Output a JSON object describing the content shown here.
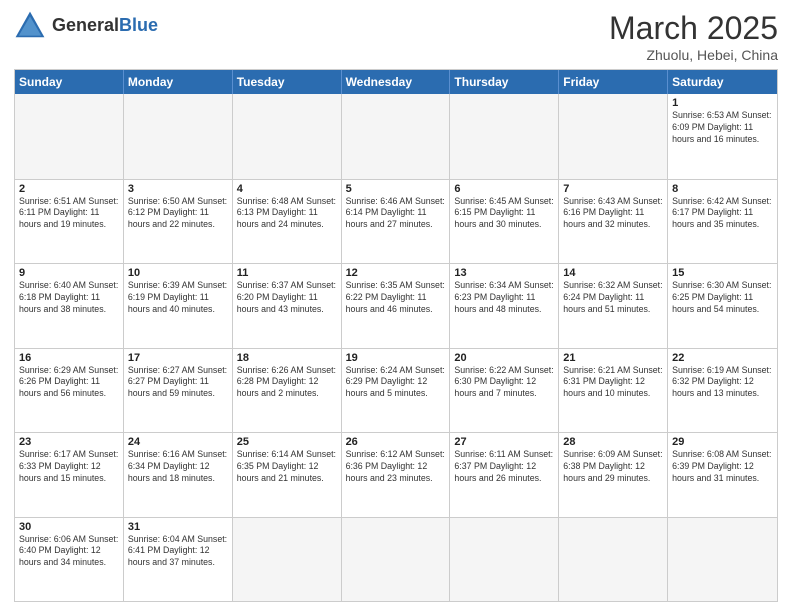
{
  "header": {
    "logo_general": "General",
    "logo_blue": "Blue",
    "month_title": "March 2025",
    "location": "Zhuolu, Hebei, China"
  },
  "weekdays": [
    "Sunday",
    "Monday",
    "Tuesday",
    "Wednesday",
    "Thursday",
    "Friday",
    "Saturday"
  ],
  "weeks": [
    [
      {
        "day": "",
        "info": ""
      },
      {
        "day": "",
        "info": ""
      },
      {
        "day": "",
        "info": ""
      },
      {
        "day": "",
        "info": ""
      },
      {
        "day": "",
        "info": ""
      },
      {
        "day": "",
        "info": ""
      },
      {
        "day": "1",
        "info": "Sunrise: 6:53 AM\nSunset: 6:09 PM\nDaylight: 11 hours\nand 16 minutes."
      }
    ],
    [
      {
        "day": "2",
        "info": "Sunrise: 6:51 AM\nSunset: 6:11 PM\nDaylight: 11 hours\nand 19 minutes."
      },
      {
        "day": "3",
        "info": "Sunrise: 6:50 AM\nSunset: 6:12 PM\nDaylight: 11 hours\nand 22 minutes."
      },
      {
        "day": "4",
        "info": "Sunrise: 6:48 AM\nSunset: 6:13 PM\nDaylight: 11 hours\nand 24 minutes."
      },
      {
        "day": "5",
        "info": "Sunrise: 6:46 AM\nSunset: 6:14 PM\nDaylight: 11 hours\nand 27 minutes."
      },
      {
        "day": "6",
        "info": "Sunrise: 6:45 AM\nSunset: 6:15 PM\nDaylight: 11 hours\nand 30 minutes."
      },
      {
        "day": "7",
        "info": "Sunrise: 6:43 AM\nSunset: 6:16 PM\nDaylight: 11 hours\nand 32 minutes."
      },
      {
        "day": "8",
        "info": "Sunrise: 6:42 AM\nSunset: 6:17 PM\nDaylight: 11 hours\nand 35 minutes."
      }
    ],
    [
      {
        "day": "9",
        "info": "Sunrise: 6:40 AM\nSunset: 6:18 PM\nDaylight: 11 hours\nand 38 minutes."
      },
      {
        "day": "10",
        "info": "Sunrise: 6:39 AM\nSunset: 6:19 PM\nDaylight: 11 hours\nand 40 minutes."
      },
      {
        "day": "11",
        "info": "Sunrise: 6:37 AM\nSunset: 6:20 PM\nDaylight: 11 hours\nand 43 minutes."
      },
      {
        "day": "12",
        "info": "Sunrise: 6:35 AM\nSunset: 6:22 PM\nDaylight: 11 hours\nand 46 minutes."
      },
      {
        "day": "13",
        "info": "Sunrise: 6:34 AM\nSunset: 6:23 PM\nDaylight: 11 hours\nand 48 minutes."
      },
      {
        "day": "14",
        "info": "Sunrise: 6:32 AM\nSunset: 6:24 PM\nDaylight: 11 hours\nand 51 minutes."
      },
      {
        "day": "15",
        "info": "Sunrise: 6:30 AM\nSunset: 6:25 PM\nDaylight: 11 hours\nand 54 minutes."
      }
    ],
    [
      {
        "day": "16",
        "info": "Sunrise: 6:29 AM\nSunset: 6:26 PM\nDaylight: 11 hours\nand 56 minutes."
      },
      {
        "day": "17",
        "info": "Sunrise: 6:27 AM\nSunset: 6:27 PM\nDaylight: 11 hours\nand 59 minutes."
      },
      {
        "day": "18",
        "info": "Sunrise: 6:26 AM\nSunset: 6:28 PM\nDaylight: 12 hours\nand 2 minutes."
      },
      {
        "day": "19",
        "info": "Sunrise: 6:24 AM\nSunset: 6:29 PM\nDaylight: 12 hours\nand 5 minutes."
      },
      {
        "day": "20",
        "info": "Sunrise: 6:22 AM\nSunset: 6:30 PM\nDaylight: 12 hours\nand 7 minutes."
      },
      {
        "day": "21",
        "info": "Sunrise: 6:21 AM\nSunset: 6:31 PM\nDaylight: 12 hours\nand 10 minutes."
      },
      {
        "day": "22",
        "info": "Sunrise: 6:19 AM\nSunset: 6:32 PM\nDaylight: 12 hours\nand 13 minutes."
      }
    ],
    [
      {
        "day": "23",
        "info": "Sunrise: 6:17 AM\nSunset: 6:33 PM\nDaylight: 12 hours\nand 15 minutes."
      },
      {
        "day": "24",
        "info": "Sunrise: 6:16 AM\nSunset: 6:34 PM\nDaylight: 12 hours\nand 18 minutes."
      },
      {
        "day": "25",
        "info": "Sunrise: 6:14 AM\nSunset: 6:35 PM\nDaylight: 12 hours\nand 21 minutes."
      },
      {
        "day": "26",
        "info": "Sunrise: 6:12 AM\nSunset: 6:36 PM\nDaylight: 12 hours\nand 23 minutes."
      },
      {
        "day": "27",
        "info": "Sunrise: 6:11 AM\nSunset: 6:37 PM\nDaylight: 12 hours\nand 26 minutes."
      },
      {
        "day": "28",
        "info": "Sunrise: 6:09 AM\nSunset: 6:38 PM\nDaylight: 12 hours\nand 29 minutes."
      },
      {
        "day": "29",
        "info": "Sunrise: 6:08 AM\nSunset: 6:39 PM\nDaylight: 12 hours\nand 31 minutes."
      }
    ],
    [
      {
        "day": "30",
        "info": "Sunrise: 6:06 AM\nSunset: 6:40 PM\nDaylight: 12 hours\nand 34 minutes."
      },
      {
        "day": "31",
        "info": "Sunrise: 6:04 AM\nSunset: 6:41 PM\nDaylight: 12 hours\nand 37 minutes."
      },
      {
        "day": "",
        "info": ""
      },
      {
        "day": "",
        "info": ""
      },
      {
        "day": "",
        "info": ""
      },
      {
        "day": "",
        "info": ""
      },
      {
        "day": "",
        "info": ""
      }
    ]
  ]
}
